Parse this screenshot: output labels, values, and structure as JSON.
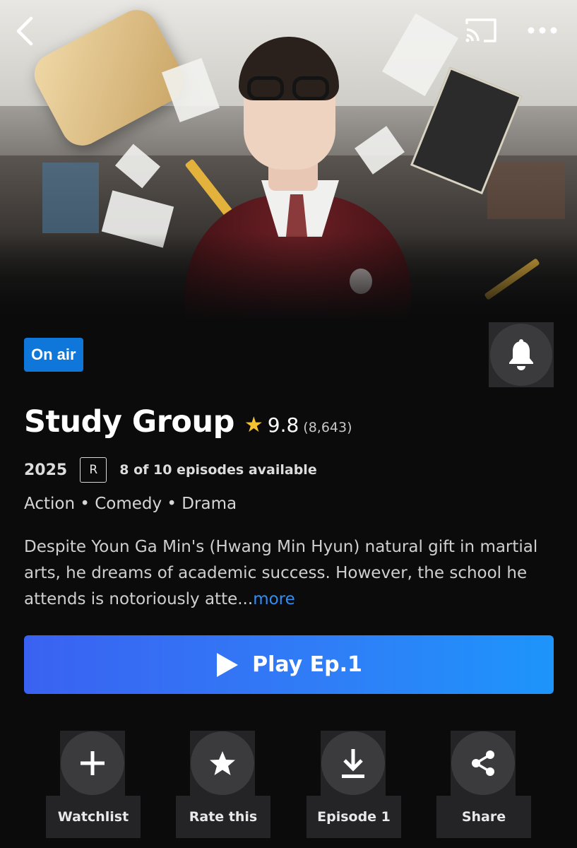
{
  "header": {
    "back_icon": "chevron-left-icon",
    "cast_icon": "cast-icon",
    "more_icon": "more-horizontal-icon"
  },
  "status": {
    "on_air_label": "On air"
  },
  "notify": {
    "icon": "bell-icon"
  },
  "show": {
    "title": "Study Group",
    "rating": "9.8",
    "rating_count": "(8,643)",
    "year": "2025",
    "content_rating": "R",
    "episodes_available": "8 of 10 episodes available",
    "genres": "Action • Comedy • Drama",
    "description": "Despite Youn Ga Min's (Hwang Min Hyun) natural gift in martial arts, he dreams of academic success. However, the school he attends is notoriously atte...",
    "more_label": "more"
  },
  "play": {
    "label": "Play Ep.1"
  },
  "actions": [
    {
      "label": "Watchlist",
      "icon": "plus-icon"
    },
    {
      "label": "Rate this",
      "icon": "star-icon"
    },
    {
      "label": "Episode 1",
      "icon": "download-icon"
    },
    {
      "label": "Share",
      "icon": "share-icon"
    }
  ],
  "colors": {
    "accent_blue": "#0f77d9",
    "play_gradient_start": "#3a62f2",
    "play_gradient_end": "#1d95fb",
    "star_yellow": "#f6c232",
    "link_blue": "#2f8ef5",
    "background": "#0b0b0c"
  }
}
